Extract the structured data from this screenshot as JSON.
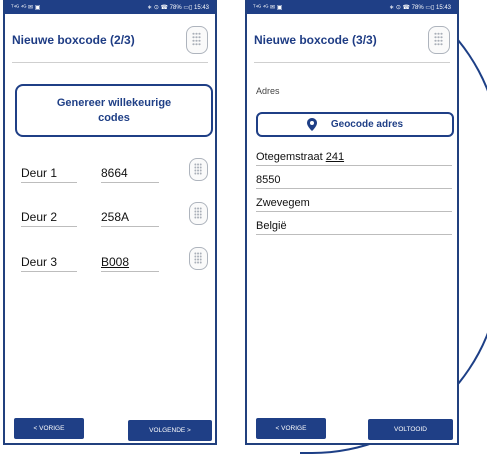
{
  "left": {
    "status": {
      "left": "ᵀ⁴ᴳ ⁴ᴳ ✉ ▣",
      "right": "∗ ⊙ ☎ 78% ▭▯ 15:43"
    },
    "title": "Nieuwe boxcode (2/3)",
    "generate_button": "Genereer willekeurige codes",
    "doors": [
      {
        "label": "Deur 1",
        "code": "8664"
      },
      {
        "label": "Deur 2",
        "code": "258A"
      },
      {
        "label": "Deur 3",
        "code": "B008"
      }
    ],
    "prev_button": "< VORIGE",
    "next_button": "VOLGENDE >"
  },
  "right": {
    "status": {
      "left": "ᵀ⁴ᴳ ⁴ᴳ ✉ ▣",
      "right": "∗ ⊙ ☎ 78% ▭▯ 15:43"
    },
    "title": "Nieuwe boxcode (3/3)",
    "address_label": "Adres",
    "geocode_button": "Geocode adres",
    "address": {
      "street": "Otegemstraat",
      "number": "241",
      "postal": "8550",
      "city": "Zwevegem",
      "country": "België"
    },
    "prev_button": "< VORIGE",
    "done_button": "VOLTOOID"
  },
  "colors": {
    "accent": "#1f3f86"
  },
  "icons": {
    "keypad": "keypad-icon",
    "location": "location-pin-icon"
  }
}
